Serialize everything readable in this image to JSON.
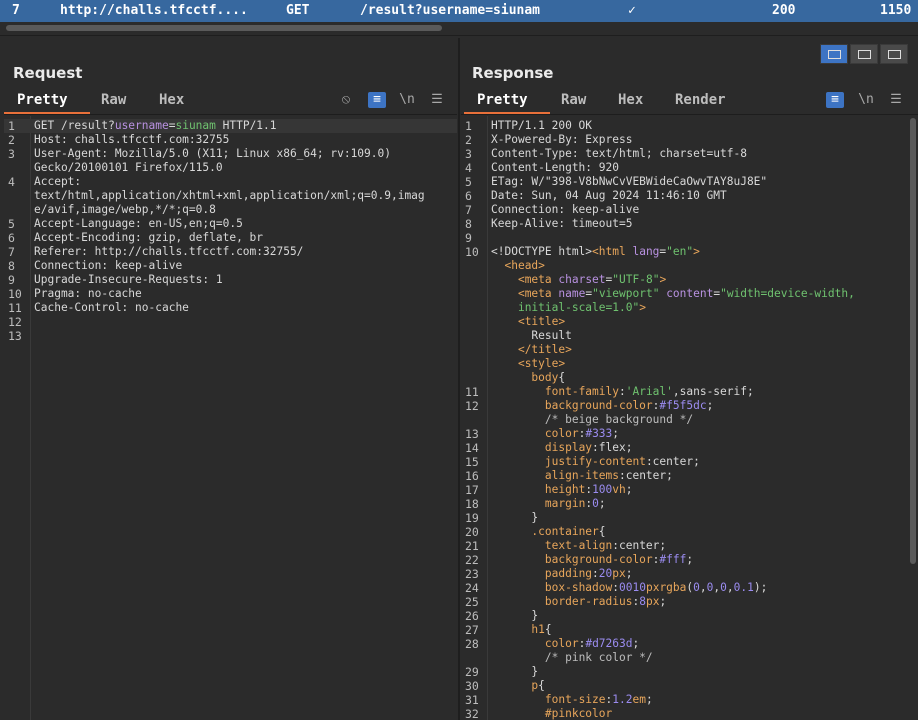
{
  "history_row": {
    "id": "7",
    "host": "http://challs.tfcctf....",
    "method": "GET",
    "url": "/result?username=siunam",
    "edited": "✓",
    "status": "200",
    "length": "1150"
  },
  "request": {
    "title": "Request",
    "tabs": [
      "Pretty",
      "Raw",
      "Hex"
    ],
    "tools": {
      "eye_off": "⦸",
      "wrap": "≡",
      "newline": "\\n",
      "menu": "☰"
    },
    "lines": [
      {
        "n": "1",
        "segs": [
          [
            "k",
            "GET /result?"
          ],
          [
            "p",
            "username"
          ],
          [
            "k",
            "="
          ],
          [
            "pv",
            "siunam"
          ],
          [
            "k",
            " HTTP/1.1"
          ]
        ]
      },
      {
        "n": "2",
        "segs": [
          [
            "k",
            "Host: challs.tfcctf.com:32755"
          ]
        ]
      },
      {
        "n": "3",
        "segs": [
          [
            "k",
            "User-Agent: Mozilla/5.0 (X11; Linux x86_64; rv:109.0)"
          ]
        ]
      },
      {
        "n": "",
        "segs": [
          [
            "k",
            "Gecko/20100101 Firefox/115.0"
          ]
        ]
      },
      {
        "n": "4",
        "segs": [
          [
            "k",
            "Accept:"
          ]
        ]
      },
      {
        "n": "",
        "segs": [
          [
            "k",
            "text/html,application/xhtml+xml,application/xml;q=0.9,imag"
          ]
        ]
      },
      {
        "n": "",
        "segs": [
          [
            "k",
            "e/avif,image/webp,*/*;q=0.8"
          ]
        ]
      },
      {
        "n": "5",
        "segs": [
          [
            "k",
            "Accept-Language: en-US,en;q=0.5"
          ]
        ]
      },
      {
        "n": "6",
        "segs": [
          [
            "k",
            "Accept-Encoding: gzip, deflate, br"
          ]
        ]
      },
      {
        "n": "7",
        "segs": [
          [
            "k",
            "Referer: http://challs.tfcctf.com:32755/"
          ]
        ]
      },
      {
        "n": "8",
        "segs": [
          [
            "k",
            "Connection: keep-alive"
          ]
        ]
      },
      {
        "n": "9",
        "segs": [
          [
            "k",
            "Upgrade-Insecure-Requests: 1"
          ]
        ]
      },
      {
        "n": "10",
        "segs": [
          [
            "k",
            "Pragma: no-cache"
          ]
        ]
      },
      {
        "n": "11",
        "segs": [
          [
            "k",
            "Cache-Control: no-cache"
          ]
        ]
      },
      {
        "n": "12",
        "segs": []
      },
      {
        "n": "13",
        "segs": []
      }
    ]
  },
  "response": {
    "title": "Response",
    "tabs": [
      "Pretty",
      "Raw",
      "Hex",
      "Render"
    ],
    "tools": {
      "wrap": "≡",
      "newline": "\\n",
      "menu": "☰"
    },
    "lines": [
      {
        "n": "1",
        "segs": [
          [
            "k",
            "HTTP/1.1 200 OK"
          ]
        ]
      },
      {
        "n": "2",
        "segs": [
          [
            "k",
            "X-Powered-By: Express"
          ]
        ]
      },
      {
        "n": "3",
        "segs": [
          [
            "k",
            "Content-Type: text/html; charset=utf-8"
          ]
        ]
      },
      {
        "n": "4",
        "segs": [
          [
            "k",
            "Content-Length: 920"
          ]
        ]
      },
      {
        "n": "5",
        "segs": [
          [
            "k",
            "ETag: W/\"398-V8bNwCvVEBWideCaOwvTAY8uJ8E\""
          ]
        ]
      },
      {
        "n": "6",
        "segs": [
          [
            "k",
            "Date: Sun, 04 Aug 2024 11:46:10 GMT"
          ]
        ]
      },
      {
        "n": "7",
        "segs": [
          [
            "k",
            "Connection: keep-alive"
          ]
        ]
      },
      {
        "n": "8",
        "segs": [
          [
            "k",
            "Keep-Alive: timeout=5"
          ]
        ]
      },
      {
        "n": "9",
        "segs": []
      },
      {
        "n": "10",
        "segs": [
          [
            "k",
            "<!DOCTYPE html>"
          ],
          [
            "tag",
            "<html "
          ],
          [
            "attr",
            "lang"
          ],
          [
            "k",
            "="
          ],
          [
            "str",
            "\"en\""
          ],
          [
            "tag",
            ">"
          ]
        ]
      },
      {
        "n": "",
        "segs": [
          [
            "k",
            "  "
          ],
          [
            "tag",
            "<head>"
          ]
        ]
      },
      {
        "n": "",
        "segs": [
          [
            "k",
            "    "
          ],
          [
            "tag",
            "<meta "
          ],
          [
            "attr",
            "charset"
          ],
          [
            "k",
            "="
          ],
          [
            "str",
            "\"UTF-8\""
          ],
          [
            "tag",
            ">"
          ]
        ]
      },
      {
        "n": "",
        "segs": [
          [
            "k",
            "    "
          ],
          [
            "tag",
            "<meta "
          ],
          [
            "attr",
            "name"
          ],
          [
            "k",
            "="
          ],
          [
            "str",
            "\"viewport\""
          ],
          [
            "k",
            " "
          ],
          [
            "attr",
            "content"
          ],
          [
            "k",
            "="
          ],
          [
            "str",
            "\"width=device-width,"
          ]
        ]
      },
      {
        "n": "",
        "segs": [
          [
            "k",
            "    "
          ],
          [
            "str",
            "initial-scale=1.0\""
          ],
          [
            "tag",
            ">"
          ]
        ]
      },
      {
        "n": "",
        "segs": [
          [
            "k",
            "    "
          ],
          [
            "tag",
            "<title>"
          ]
        ]
      },
      {
        "n": "",
        "segs": [
          [
            "k",
            "      Result"
          ]
        ]
      },
      {
        "n": "",
        "segs": [
          [
            "k",
            "    "
          ],
          [
            "tag",
            "</title>"
          ]
        ]
      },
      {
        "n": "",
        "segs": [
          [
            "k",
            "    "
          ],
          [
            "tag",
            "<style>"
          ]
        ]
      },
      {
        "n": "",
        "segs": [
          [
            "k",
            "      "
          ],
          [
            "tag",
            "body"
          ],
          [
            "k",
            "{"
          ]
        ]
      },
      {
        "n": "11",
        "segs": [
          [
            "k",
            "        "
          ],
          [
            "css-p",
            "font-family"
          ],
          [
            "k",
            ":"
          ],
          [
            "str",
            "'Arial'"
          ],
          [
            "k",
            ",sans-serif;"
          ]
        ]
      },
      {
        "n": "12",
        "segs": [
          [
            "k",
            "        "
          ],
          [
            "css-p",
            "background-color"
          ],
          [
            "k",
            ":"
          ],
          [
            "num",
            "#f5f5dc"
          ],
          [
            "k",
            ";"
          ]
        ]
      },
      {
        "n": "",
        "segs": [
          [
            "k",
            "        "
          ],
          [
            "cm",
            "/* beige background */"
          ]
        ]
      },
      {
        "n": "13",
        "segs": [
          [
            "k",
            "        "
          ],
          [
            "css-p",
            "color"
          ],
          [
            "k",
            ":"
          ],
          [
            "num",
            "#333"
          ],
          [
            "k",
            ";"
          ]
        ]
      },
      {
        "n": "14",
        "segs": [
          [
            "k",
            "        "
          ],
          [
            "css-p",
            "display"
          ],
          [
            "k",
            ":flex;"
          ]
        ]
      },
      {
        "n": "15",
        "segs": [
          [
            "k",
            "        "
          ],
          [
            "css-p",
            "justify-content"
          ],
          [
            "k",
            ":center;"
          ]
        ]
      },
      {
        "n": "16",
        "segs": [
          [
            "k",
            "        "
          ],
          [
            "css-p",
            "align-items"
          ],
          [
            "k",
            ":center;"
          ]
        ]
      },
      {
        "n": "17",
        "segs": [
          [
            "k",
            "        "
          ],
          [
            "css-p",
            "height"
          ],
          [
            "k",
            ":"
          ],
          [
            "num",
            "100"
          ],
          [
            "css-p",
            "vh"
          ],
          [
            "k",
            ";"
          ]
        ]
      },
      {
        "n": "18",
        "segs": [
          [
            "k",
            "        "
          ],
          [
            "css-p",
            "margin"
          ],
          [
            "k",
            ":"
          ],
          [
            "num",
            "0"
          ],
          [
            "k",
            ";"
          ]
        ]
      },
      {
        "n": "19",
        "segs": [
          [
            "k",
            "      }"
          ]
        ]
      },
      {
        "n": "20",
        "segs": [
          [
            "k",
            "      "
          ],
          [
            "tag",
            ".container"
          ],
          [
            "k",
            "{"
          ]
        ]
      },
      {
        "n": "21",
        "segs": [
          [
            "k",
            "        "
          ],
          [
            "css-p",
            "text-align"
          ],
          [
            "k",
            ":center;"
          ]
        ]
      },
      {
        "n": "22",
        "segs": [
          [
            "k",
            "        "
          ],
          [
            "css-p",
            "background-color"
          ],
          [
            "k",
            ":"
          ],
          [
            "num",
            "#fff"
          ],
          [
            "k",
            ";"
          ]
        ]
      },
      {
        "n": "23",
        "segs": [
          [
            "k",
            "        "
          ],
          [
            "css-p",
            "padding"
          ],
          [
            "k",
            ":"
          ],
          [
            "num",
            "20"
          ],
          [
            "css-p",
            "px"
          ],
          [
            "k",
            ";"
          ]
        ]
      },
      {
        "n": "24",
        "segs": [
          [
            "k",
            "        "
          ],
          [
            "css-p",
            "box-shadow"
          ],
          [
            "k",
            ":"
          ],
          [
            "num",
            "0010"
          ],
          [
            "css-p",
            "px"
          ],
          [
            "tag",
            "rgba"
          ],
          [
            "k",
            "("
          ],
          [
            "num",
            "0"
          ],
          [
            "k",
            ","
          ],
          [
            "num",
            "0"
          ],
          [
            "k",
            ","
          ],
          [
            "num",
            "0"
          ],
          [
            "k",
            ","
          ],
          [
            "num",
            "0.1"
          ],
          [
            "k",
            ");"
          ]
        ]
      },
      {
        "n": "25",
        "segs": [
          [
            "k",
            "        "
          ],
          [
            "css-p",
            "border-radius"
          ],
          [
            "k",
            ":"
          ],
          [
            "num",
            "8"
          ],
          [
            "css-p",
            "px"
          ],
          [
            "k",
            ";"
          ]
        ]
      },
      {
        "n": "26",
        "segs": [
          [
            "k",
            "      }"
          ]
        ]
      },
      {
        "n": "27",
        "segs": [
          [
            "k",
            "      "
          ],
          [
            "tag",
            "h1"
          ],
          [
            "k",
            "{"
          ]
        ]
      },
      {
        "n": "28",
        "segs": [
          [
            "k",
            "        "
          ],
          [
            "css-p",
            "color"
          ],
          [
            "k",
            ":"
          ],
          [
            "num",
            "#d7263d"
          ],
          [
            "k",
            ";"
          ]
        ]
      },
      {
        "n": "",
        "segs": [
          [
            "k",
            "        "
          ],
          [
            "cm",
            "/* pink color */"
          ]
        ]
      },
      {
        "n": "29",
        "segs": [
          [
            "k",
            "      }"
          ]
        ]
      },
      {
        "n": "30",
        "segs": [
          [
            "k",
            "      "
          ],
          [
            "tag",
            "p"
          ],
          [
            "k",
            "{"
          ]
        ]
      },
      {
        "n": "31",
        "segs": [
          [
            "k",
            "        "
          ],
          [
            "css-p",
            "font-size"
          ],
          [
            "k",
            ":"
          ],
          [
            "num",
            "1.2"
          ],
          [
            "css-p",
            "em"
          ],
          [
            "k",
            ";"
          ]
        ]
      },
      {
        "n": "32",
        "segs": [
          [
            "k",
            "        "
          ],
          [
            "tag",
            "#pinkcolor"
          ]
        ]
      }
    ]
  },
  "colors": {
    "accent": "#e8703a",
    "selected_row": "#37689f",
    "toggle_on": "#3d74c4"
  }
}
